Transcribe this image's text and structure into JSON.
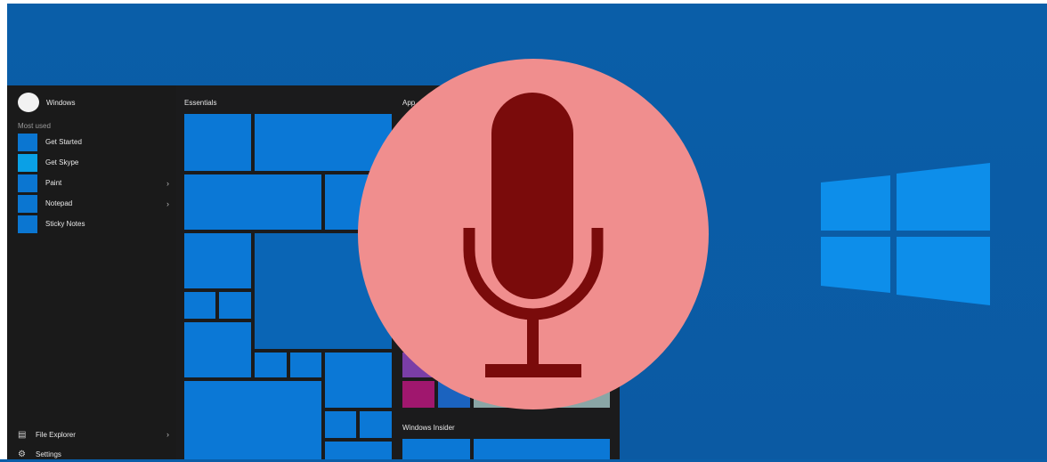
{
  "start_menu": {
    "user_name": "Windows",
    "most_used_label": "Most used",
    "apps": [
      {
        "label": "Get Started",
        "has_submenu": false
      },
      {
        "label": "Get Skype",
        "has_submenu": false
      },
      {
        "label": "Paint",
        "has_submenu": true
      },
      {
        "label": "Notepad",
        "has_submenu": true
      },
      {
        "label": "Sticky Notes",
        "has_submenu": false
      }
    ],
    "bottom": {
      "file_explorer": "File Explorer",
      "settings": "Settings"
    },
    "groups": {
      "essentials": "Essentials",
      "apps_partial": "App",
      "windows_insider": "Windows Insider"
    }
  },
  "overlay": {
    "icon": "microphone-icon",
    "circle_color": "#f08e8e",
    "mic_color": "#7a0b0b"
  },
  "brand": {
    "logo": "windows-logo-icon",
    "logo_color": "#0d8eea",
    "background_color": "#0a5ea8"
  }
}
